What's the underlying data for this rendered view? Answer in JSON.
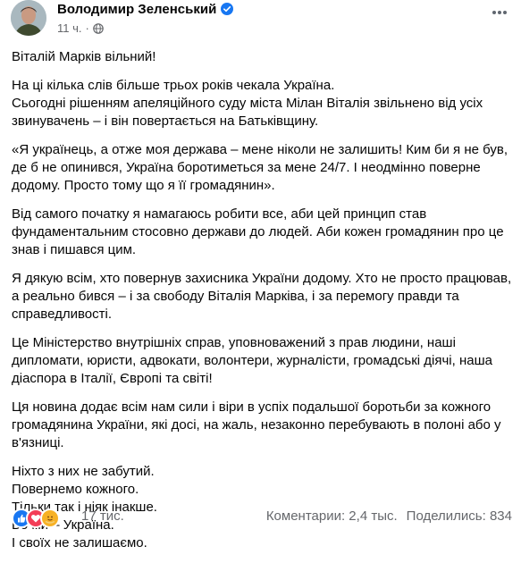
{
  "post": {
    "author": "Володимир Зеленський",
    "time": "11 ч.",
    "dot": "·",
    "paragraphs": [
      [
        "Віталій Марків вільний!"
      ],
      [
        "На ці кілька слів більше трьох років чекала Україна.",
        "Сьогодні рішенням апеляційного суду міста Мілан Віталія звільнено від усіх",
        "звинувачень – і він повертається на Батьківщину."
      ],
      [
        "«Я українець, а отже моя держава – мене ніколи не залишить! Ким би я не був,",
        "де б не опинився, Україна боротиметься за мене 24/7. І неодмінно поверне",
        "додому. Просто тому що я її громадянин»."
      ],
      [
        "Від самого початку я намагаюсь робити все, аби цей принцип став",
        "фундаментальним стосовно держави до людей. Аби кожен громадянин про це",
        "знав і пишався цим."
      ],
      [
        "Я дякую всім, хто повернув захисника України додому. Хто не просто працював,",
        "а реально бився – і за свободу Віталія Марківа, і за перемогу правди та",
        "справедливості."
      ],
      [
        "Це Міністерство внутрішніх справ, уповноважений з прав людини, наші",
        "дипломати, юристи, адвокати, волонтери, журналісти, громадські діячі, наша",
        "діаспора в Італії, Європі та світі!"
      ],
      [
        "Ця новина додає всім нам сили і віри в успіх подальшої боротьби за кожного",
        "громадянина України, які досі, на жаль, незаконно перебувають в полоні або у",
        "в'язниці."
      ],
      [
        "Ніхто з них не забутий.",
        "Повернемо кожного.",
        "Тільки так і ніяк інакше.",
        "Бо ми – Україна.",
        "І своїх не залишаємо."
      ]
    ]
  },
  "footer": {
    "reactions_count": "17 тис.",
    "comments": "Коментарии: 2,4 тыс.",
    "shares": "Поделились: 834"
  },
  "icons": {
    "like": "thumbs-up-icon",
    "love": "heart-icon",
    "care": "care-emoji-icon",
    "verified": "verified-badge-icon",
    "audience": "globe-icon",
    "more": "more-options-icon"
  },
  "colors": {
    "like": "#1877f2",
    "love": "#f33e58",
    "care": "#f7b125",
    "verified": "#1877f2",
    "secondary_text": "#65676b"
  }
}
